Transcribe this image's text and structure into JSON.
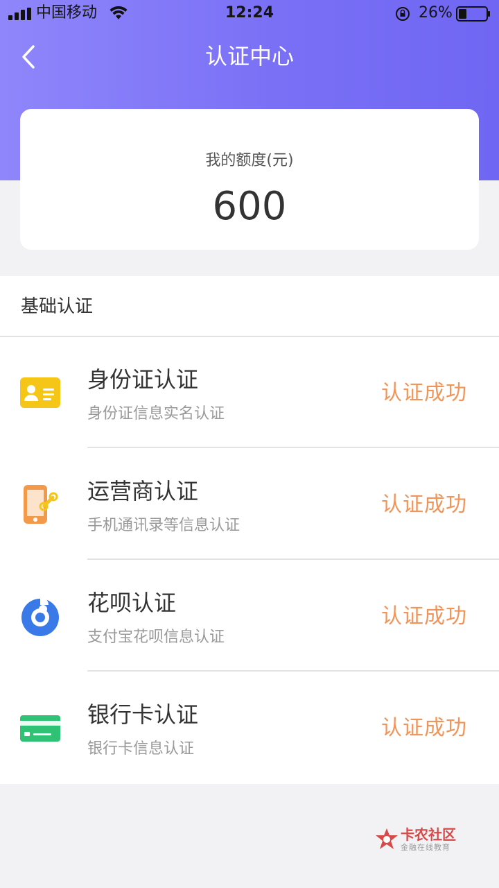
{
  "status_bar": {
    "carrier": "中国移动",
    "time": "12:24",
    "battery": "26%"
  },
  "nav": {
    "title": "认证中心"
  },
  "quota": {
    "label": "我的额度(元)",
    "amount": "600"
  },
  "section": {
    "title": "基础认证",
    "items": [
      {
        "title": "身份证认证",
        "desc": "身份证信息实名认证",
        "status": "认证成功",
        "icon": "id-card-icon"
      },
      {
        "title": "运营商认证",
        "desc": "手机通讯录等信息认证",
        "status": "认证成功",
        "icon": "mobile-carrier-icon"
      },
      {
        "title": "花呗认证",
        "desc": "支付宝花呗信息认证",
        "status": "认证成功",
        "icon": "huabei-icon"
      },
      {
        "title": "银行卡认证",
        "desc": "银行卡信息认证",
        "status": "认证成功",
        "icon": "bank-card-icon"
      }
    ]
  },
  "watermark": {
    "main": "卡农社区",
    "sub": "金融在线教育"
  },
  "colors": {
    "header_gradient_start": "#8f86fb",
    "header_gradient_end": "#6f66f3",
    "status_success": "#f0955a",
    "id_card": "#f5c518",
    "carrier": "#f39a4a",
    "huabei": "#3a7ae8",
    "bank_card": "#2fc275"
  }
}
